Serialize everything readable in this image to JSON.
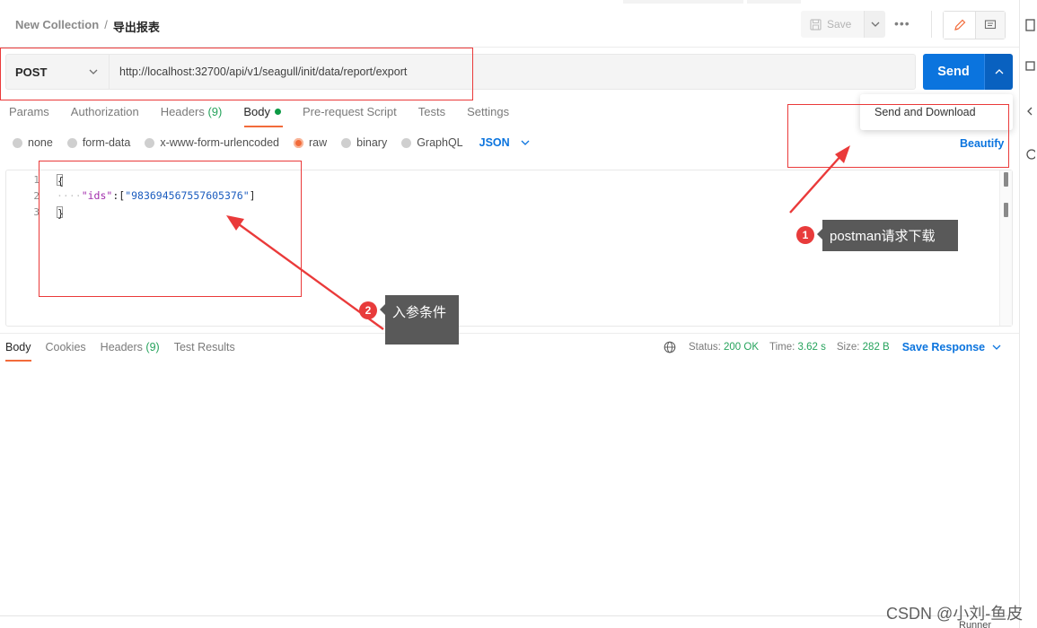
{
  "breadcrumb": {
    "collection": "New Collection",
    "separator": "/",
    "request": "导出报表"
  },
  "toolbar": {
    "save_label": "Save",
    "more_label": "•••"
  },
  "request": {
    "method": "POST",
    "url": "http://localhost:32700/api/v1/seagull/init/data/report/export",
    "send_label": "Send",
    "send_menu_item": "Send and Download"
  },
  "request_tabs": [
    {
      "label": "Params"
    },
    {
      "label": "Authorization"
    },
    {
      "label": "Headers",
      "count": "(9)"
    },
    {
      "label": "Body"
    },
    {
      "label": "Pre-request Script"
    },
    {
      "label": "Tests"
    },
    {
      "label": "Settings"
    }
  ],
  "body_types": [
    "none",
    "form-data",
    "x-www-form-urlencoded",
    "raw",
    "binary",
    "GraphQL"
  ],
  "selected_body_type": "raw",
  "language": "JSON",
  "beautify_label": "Beautify",
  "editor": {
    "line_numbers": [
      "1",
      "2",
      "3"
    ],
    "open_brace": "{",
    "indent": "····",
    "key": "\"ids\"",
    "colon": ":[",
    "value": "\"983694567557605376\"",
    "close_bracket": "]",
    "close_brace": "}"
  },
  "response_tabs": [
    {
      "label": "Body"
    },
    {
      "label": "Cookies"
    },
    {
      "label": "Headers",
      "count": "(9)"
    },
    {
      "label": "Test Results"
    }
  ],
  "response_meta": {
    "status_label": "Status:",
    "status_value": "200 OK",
    "time_label": "Time:",
    "time_value": "3.62 s",
    "size_label": "Size:",
    "size_value": "282 B",
    "save_response_label": "Save Response"
  },
  "annotations": {
    "badge1": "1",
    "callout1": "postman请求下载",
    "badge2": "2",
    "callout2": "入参条件"
  },
  "watermark": "CSDN @小刘-鱼皮",
  "footer": {
    "runner_label": "Runner"
  },
  "colors": {
    "accent": "#0b74de",
    "active_tab": "#f26b3a",
    "annotation": "#e83b3b",
    "success": "#26a35c"
  },
  "icons": [
    "save-icon",
    "chevron-down-icon",
    "chevron-up-icon",
    "more-icon",
    "pencil-icon",
    "comment-icon",
    "globe-icon"
  ]
}
